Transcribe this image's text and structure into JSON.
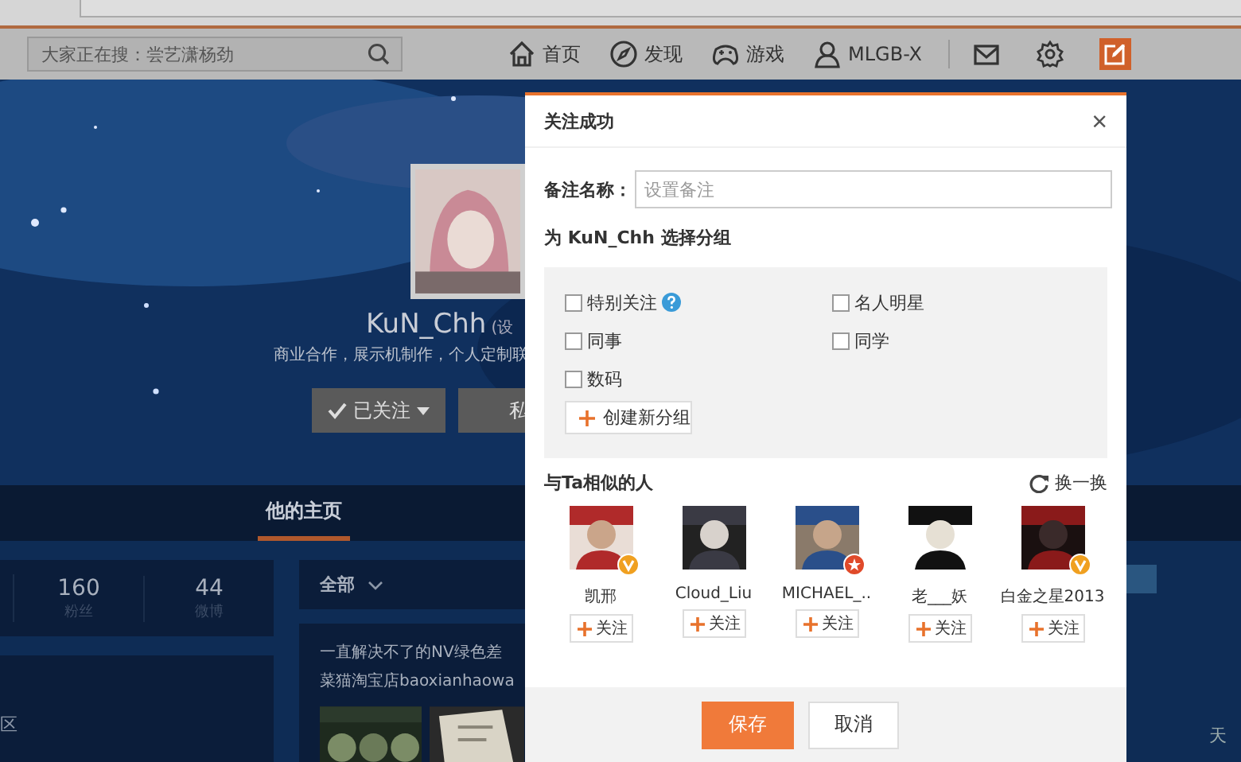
{
  "top_nav": {
    "search": {
      "placeholder": "大家正在搜：尝艺潇杨劲"
    },
    "items": [
      {
        "kind": "home",
        "label": "首页"
      },
      {
        "kind": "discover",
        "label": "发现"
      },
      {
        "kind": "game",
        "label": "游戏"
      },
      {
        "kind": "user",
        "label": "MLGB-X"
      }
    ],
    "tools": [
      {
        "kind": "mail"
      },
      {
        "kind": "settings"
      },
      {
        "kind": "compose"
      }
    ]
  },
  "profile": {
    "name": "KuN_Chh",
    "remark": "(设",
    "bio": "商业合作，展示机制作，个人定制联",
    "follow_button": "已关注",
    "message_button": "私"
  },
  "tabs": [
    {
      "label": "他的主页",
      "selected": true
    }
  ],
  "stats": [
    {
      "value": "160",
      "label": "粉丝"
    },
    {
      "value": "44",
      "label": "微博"
    }
  ],
  "sidebar_text": "区",
  "feed": {
    "filter": "全部",
    "post_lines": [
      "一直解决不了的NV绿色差",
      "菜猫淘宝店baoxianhaowa"
    ]
  },
  "right_text": "天",
  "dialog": {
    "title": "关注成功",
    "close": "×",
    "remark_label": "备注名称：",
    "remark_placeholder": "设置备注",
    "group_heading": "为 KuN_Chh 选择分组",
    "groups": [
      {
        "label": "特别关注",
        "checked": false,
        "help": true
      },
      {
        "label": "名人明星",
        "checked": false,
        "help": false
      },
      {
        "label": "同事",
        "checked": false,
        "help": false
      },
      {
        "label": "同学",
        "checked": false,
        "help": false
      },
      {
        "label": "数码",
        "checked": false,
        "help": false
      }
    ],
    "create_group": "创建新分组",
    "similar_heading": "与Ta相似的人",
    "refresh": "换一换",
    "people": [
      {
        "name": "凯邢",
        "kind": "verified",
        "follow": "关注"
      },
      {
        "name": "Cloud_Liu",
        "kind": "plain",
        "follow": "关注"
      },
      {
        "name": "MICHAEL_..",
        "kind": "star",
        "follow": "关注"
      },
      {
        "name": "老___妖",
        "kind": "plain",
        "follow": "关注"
      },
      {
        "name": "白金之星2013",
        "kind": "verified",
        "follow": "关注"
      }
    ],
    "save": "保存",
    "cancel": "取消"
  }
}
